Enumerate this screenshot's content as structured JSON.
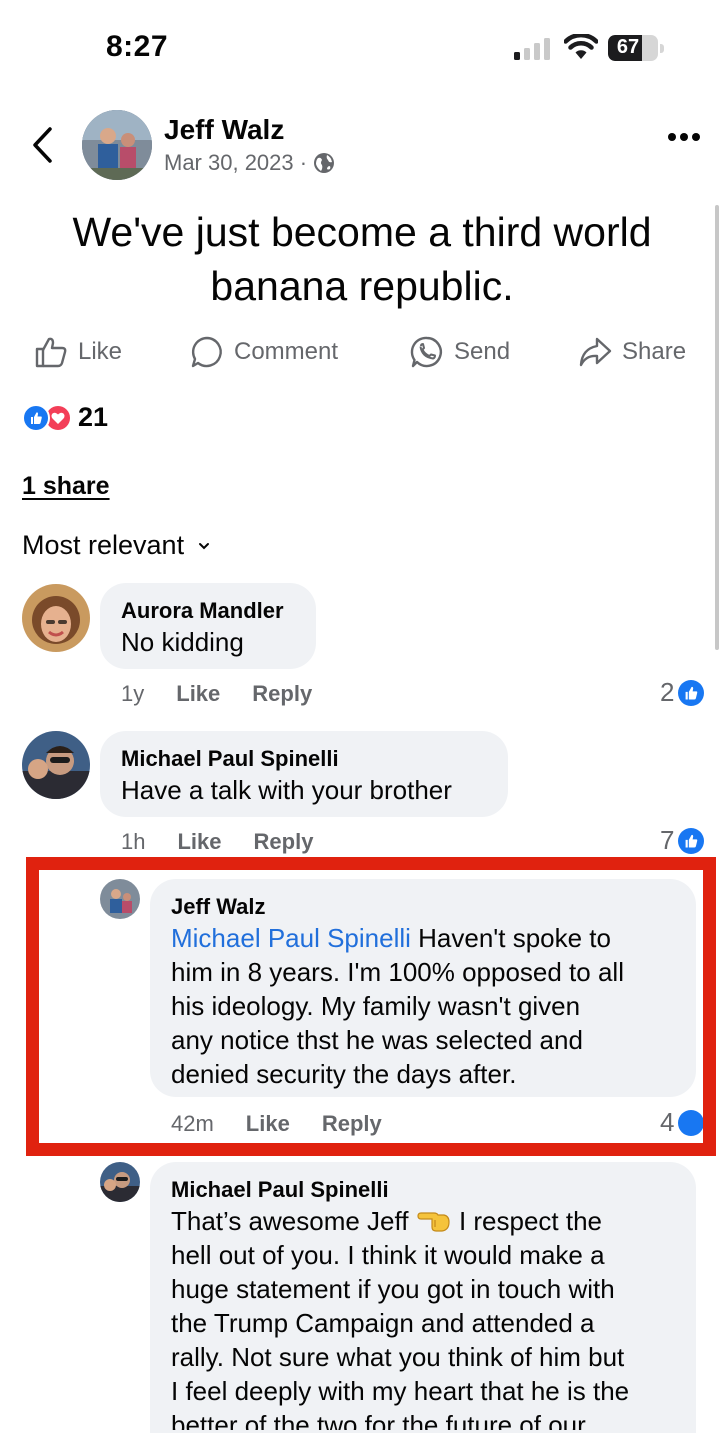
{
  "status_bar": {
    "time": "8:27",
    "battery": "67",
    "battery_level": 0.67
  },
  "post": {
    "author": "Jeff Walz",
    "date": "Mar 30, 2023 ·",
    "audience_icon": "globe-icon",
    "text": "We've just become a third world banana republic.",
    "actions": {
      "like": "Like",
      "comment": "Comment",
      "send": "Send",
      "share": "Share"
    },
    "reaction_count": "21",
    "shares": "1 share",
    "sort": "Most relevant"
  },
  "comments": [
    {
      "name": "Aurora Mandler",
      "text": "No kidding",
      "age": "1y",
      "like": "Like",
      "reply": "Reply",
      "likes": "2"
    },
    {
      "name": "Michael Paul Spinelli",
      "text": "Have a talk with your brother",
      "age": "1h",
      "like": "Like",
      "reply": "Reply",
      "likes": "7"
    }
  ],
  "replies": [
    {
      "name": "Jeff Walz",
      "mention": "Michael Paul Spinelli",
      "line1": " Haven't spoke to",
      "line2": "him in 8 years.  I'm 100% opposed to all",
      "line3": "his ideology.  My family wasn't given",
      "line4": "any notice thst he was selected and",
      "line5": "denied security the days after.",
      "age": "42m",
      "like": "Like",
      "reply": "Reply",
      "likes": "4",
      "highlighted": true
    },
    {
      "name": "Michael Paul Spinelli",
      "line1a": "That’s awesome Jeff ",
      "line1b": " I respect the",
      "line2": "hell out of you. I think it would make a",
      "line3": "huge statement if you got in touch with",
      "line4": "the Trump Campaign and attended a",
      "line5": "rally. Not sure what you think of him but",
      "line6": "I feel deeply with my heart that he is the",
      "line7": "better of the two for the future of our",
      "emoji_icon": "pointing-hand-emoji-icon"
    }
  ],
  "colors": {
    "link": "#216fdb",
    "highlight_border": "#e0220f",
    "bubble": "#f0f2f5",
    "like_blue": "#1877f2",
    "love_red": "#f33e58"
  }
}
